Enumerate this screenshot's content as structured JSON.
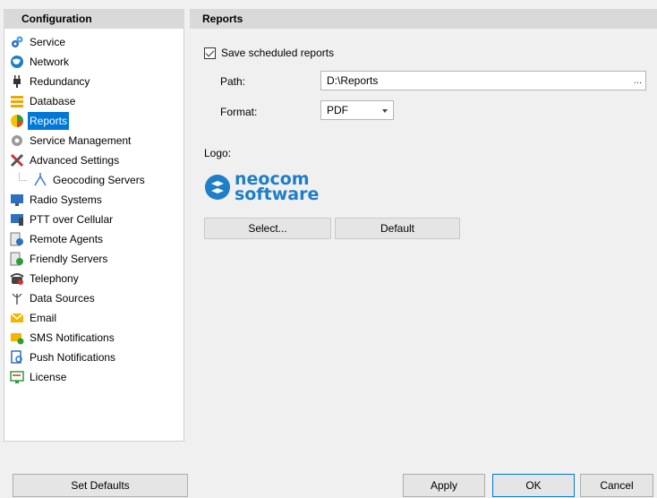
{
  "sidebar": {
    "header": "Configuration",
    "items": [
      {
        "label": "Service",
        "icon": "gears-icon"
      },
      {
        "label": "Network",
        "icon": "globe-icon"
      },
      {
        "label": "Redundancy",
        "icon": "plug-icon"
      },
      {
        "label": "Database",
        "icon": "database-icon"
      },
      {
        "label": "Reports",
        "icon": "reports-icon",
        "selected": true
      },
      {
        "label": "Service Management",
        "icon": "gear-icon"
      },
      {
        "label": "Advanced Settings",
        "icon": "tools-icon"
      },
      {
        "label": "Geocoding Servers",
        "icon": "geocoding-icon",
        "child": true
      },
      {
        "label": "Radio Systems",
        "icon": "monitor-icon"
      },
      {
        "label": "PTT over Cellular",
        "icon": "cellular-icon"
      },
      {
        "label": "Remote Agents",
        "icon": "agents-icon"
      },
      {
        "label": "Friendly Servers",
        "icon": "servers-icon"
      },
      {
        "label": "Telephony",
        "icon": "telephone-icon"
      },
      {
        "label": "Data Sources",
        "icon": "antenna-icon"
      },
      {
        "label": "Email",
        "icon": "envelope-icon"
      },
      {
        "label": "SMS Notifications",
        "icon": "sms-icon"
      },
      {
        "label": "Push Notifications",
        "icon": "push-icon"
      },
      {
        "label": "License",
        "icon": "license-icon"
      }
    ]
  },
  "main": {
    "header": "Reports",
    "save_checkbox_label": "Save scheduled reports",
    "save_checked": true,
    "path_label": "Path:",
    "path_value": "D:\\Reports",
    "browse_label": "...",
    "format_label": "Format:",
    "format_value": "PDF",
    "logo_label": "Logo:",
    "logo_line1": "neocom",
    "logo_line2": "software",
    "select_button": "Select...",
    "default_button": "Default"
  },
  "footer": {
    "set_defaults": "Set Defaults",
    "apply": "Apply",
    "ok": "OK",
    "cancel": "Cancel"
  },
  "colors": {
    "accent": "#0078d7",
    "logo": "#1e7ec8"
  }
}
